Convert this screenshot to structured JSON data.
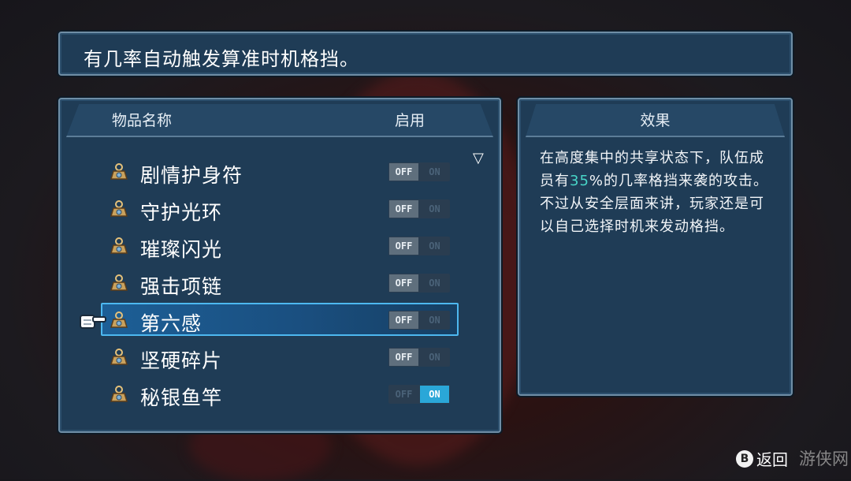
{
  "tip": {
    "text": "有几率自动触发算准时机格挡。"
  },
  "items_panel": {
    "col_name": "物品名称",
    "col_enable": "启用",
    "scroll_glyph": "▽",
    "items": [
      {
        "label": "剧情护身符",
        "off": "OFF",
        "on": "ON",
        "enabled": false,
        "icon": "amulet-icon"
      },
      {
        "label": "守护光环",
        "off": "OFF",
        "on": "ON",
        "enabled": false,
        "icon": "amulet-icon"
      },
      {
        "label": "璀璨闪光",
        "off": "OFF",
        "on": "ON",
        "enabled": false,
        "icon": "amulet-icon"
      },
      {
        "label": "强击项链",
        "off": "OFF",
        "on": "ON",
        "enabled": false,
        "icon": "amulet-icon"
      },
      {
        "label": "第六感",
        "off": "OFF",
        "on": "ON",
        "enabled": false,
        "selected": true,
        "icon": "amulet-icon"
      },
      {
        "label": "坚硬碎片",
        "off": "OFF",
        "on": "ON",
        "enabled": false,
        "icon": "amulet-icon"
      },
      {
        "label": "秘银鱼竿",
        "off": "OFF",
        "on": "ON",
        "enabled": true,
        "icon": "amulet-icon"
      }
    ]
  },
  "effect_panel": {
    "title": "效果",
    "text_before": "在高度集中的共享状态下，队伍成员有",
    "highlight": "35",
    "text_after": "%的几率格挡来袭的攻击。不过从安全层面来讲，玩家还是可以自己选择时机来发动格挡。"
  },
  "footer": {
    "button_glyph": "B",
    "back_label": "返回",
    "watermark": "游侠网"
  },
  "colors": {
    "accent": "#2aa7d8",
    "highlight": "#48d6c8",
    "panel": "#1f3c56"
  }
}
